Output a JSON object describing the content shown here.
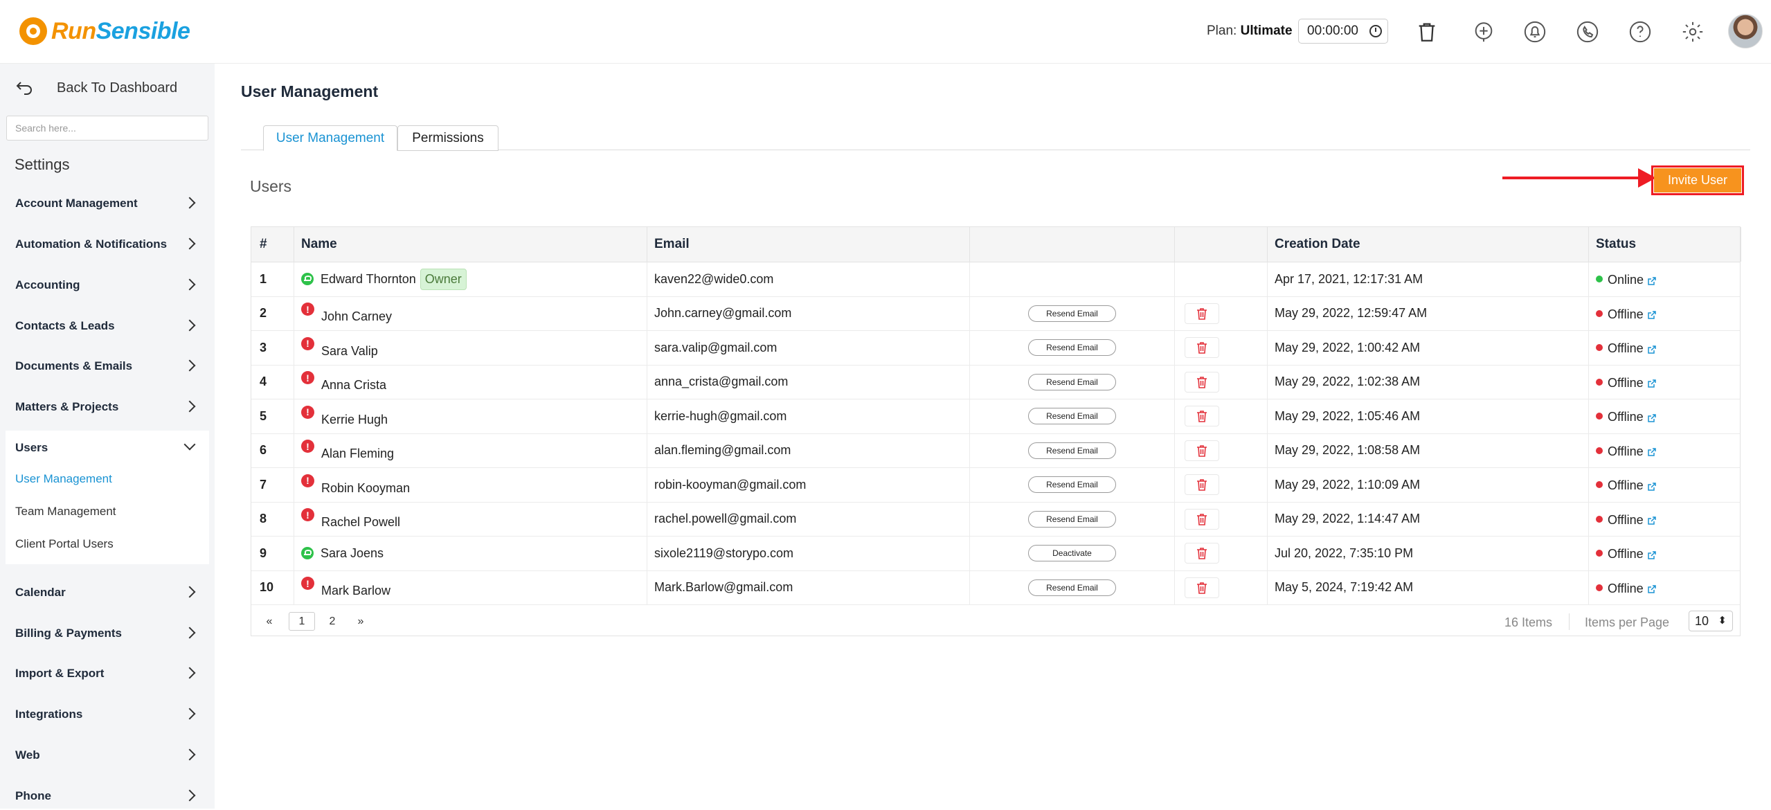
{
  "header": {
    "logo_run": "Run",
    "logo_sensible": "Sensible",
    "plan_label": "Plan: ",
    "plan_value": "Ultimate",
    "timer": "00:00:00",
    "icons": [
      "trash-icon",
      "add-task-icon",
      "bell-icon",
      "phone-icon",
      "help-icon",
      "gear-icon",
      "avatar"
    ]
  },
  "sidebar": {
    "back_label": "Back To Dashboard",
    "search_placeholder": "Search here...",
    "settings_title": "Settings",
    "items": [
      "Account Management",
      "Automation & Notifications",
      "Accounting",
      "Contacts & Leads",
      "Documents & Emails",
      "Matters & Projects",
      "Users",
      "Calendar",
      "Billing & Payments",
      "Import & Export",
      "Integrations",
      "Web",
      "Phone"
    ],
    "users_sub": [
      "User Management",
      "Team Management",
      "Client Portal Users"
    ]
  },
  "main": {
    "page_title": "User Management",
    "tabs": [
      "User Management",
      "Permissions"
    ],
    "users_heading": "Users",
    "invite_label": "Invite User",
    "columns": [
      "#",
      "Name",
      "Email",
      "",
      "",
      "Creation Date",
      "Status"
    ],
    "rows": [
      {
        "num": "1",
        "name": "Edward Thornton",
        "badge": "Owner",
        "verified": true,
        "email": "kaven22@wide0.com",
        "action": "",
        "date": "Apr 17, 2021, 12:17:31 AM",
        "status": "Online"
      },
      {
        "num": "2",
        "name": "John Carney",
        "verified": false,
        "email": "John.carney@gmail.com",
        "action": "Resend Email",
        "date": "May 29, 2022, 12:59:47 AM",
        "status": "Offline"
      },
      {
        "num": "3",
        "name": "Sara Valip",
        "verified": false,
        "email": "sara.valip@gmail.com",
        "action": "Resend Email",
        "date": "May 29, 2022, 1:00:42 AM",
        "status": "Offline"
      },
      {
        "num": "4",
        "name": "Anna Crista",
        "verified": false,
        "email": "anna_crista@gmail.com",
        "action": "Resend Email",
        "date": "May 29, 2022, 1:02:38 AM",
        "status": "Offline"
      },
      {
        "num": "5",
        "name": "Kerrie Hugh",
        "verified": false,
        "email": "kerrie-hugh@gmail.com",
        "action": "Resend Email",
        "date": "May 29, 2022, 1:05:46 AM",
        "status": "Offline"
      },
      {
        "num": "6",
        "name": "Alan Fleming",
        "verified": false,
        "email": "alan.fleming@gmail.com",
        "action": "Resend Email",
        "date": "May 29, 2022, 1:08:58 AM",
        "status": "Offline"
      },
      {
        "num": "7",
        "name": "Robin Kooyman",
        "verified": false,
        "email": "robin-kooyman@gmail.com",
        "action": "Resend Email",
        "date": "May 29, 2022, 1:10:09 AM",
        "status": "Offline"
      },
      {
        "num": "8",
        "name": "Rachel Powell",
        "verified": false,
        "email": "rachel.powell@gmail.com",
        "action": "Resend Email",
        "date": "May 29, 2022, 1:14:47 AM",
        "status": "Offline"
      },
      {
        "num": "9",
        "name": "Sara Joens",
        "verified": true,
        "email": "sixole2119@storypo.com",
        "action": "Deactivate",
        "date": "Jul 20, 2022, 7:35:10 PM",
        "status": "Offline"
      },
      {
        "num": "10",
        "name": "Mark Barlow",
        "verified": false,
        "email": "Mark.Barlow@gmail.com",
        "action": "Resend Email",
        "date": "May 5, 2024, 7:19:42 AM",
        "status": "Offline"
      }
    ],
    "pagination": {
      "prev": "«",
      "pages": [
        "1",
        "2"
      ],
      "next": "»",
      "items_count": "16 Items",
      "items_per_page_label": "Items per Page",
      "items_per_page": "10"
    }
  },
  "colors": {
    "accent": "#1a93d3",
    "invite_bg": "#f7931e",
    "annotation": "#ee1c24",
    "online": "#2ec24a",
    "offline": "#e3303a"
  }
}
